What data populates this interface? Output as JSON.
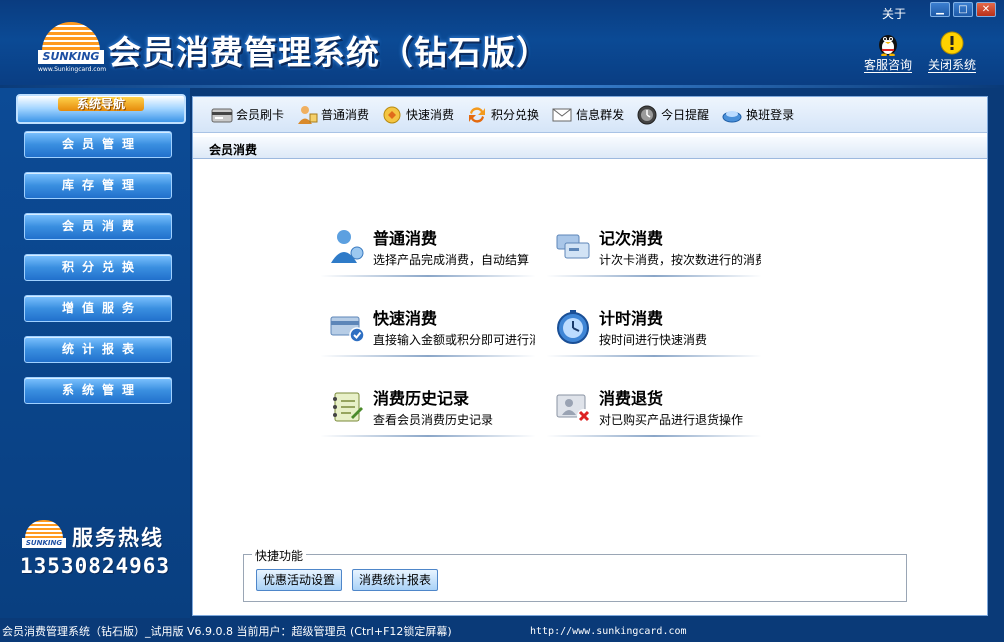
{
  "header": {
    "logo_text": "SUNKING",
    "logo_url": "www.Sunkingcard.com",
    "title": "会员消费管理系统（钻石版）",
    "about": "关于",
    "actions": [
      {
        "label": "客服咨询",
        "icon": "penguin-icon"
      },
      {
        "label": "关闭系统",
        "icon": "warning-icon"
      }
    ]
  },
  "sidebar": {
    "header": "系统导航",
    "items": [
      {
        "label": "会员管理"
      },
      {
        "label": "库存管理"
      },
      {
        "label": "会员消费"
      },
      {
        "label": "积分兑换"
      },
      {
        "label": "增值服务"
      },
      {
        "label": "统计报表"
      },
      {
        "label": "系统管理"
      }
    ],
    "hotline_label": "服务热线",
    "hotline_number": "13530824963",
    "mini_logo_text": "SUNKING"
  },
  "toolbar": {
    "items": [
      {
        "label": "会员刷卡",
        "icon": "card-reader-icon"
      },
      {
        "label": "普通消费",
        "icon": "user-purchase-icon"
      },
      {
        "label": "快速消费",
        "icon": "fast-purchase-icon"
      },
      {
        "label": "积分兑换",
        "icon": "exchange-icon"
      },
      {
        "label": "信息群发",
        "icon": "mail-icon"
      },
      {
        "label": "今日提醒",
        "icon": "reminder-icon"
      },
      {
        "label": "换班登录",
        "icon": "shift-login-icon"
      }
    ]
  },
  "page": {
    "section_title": "会员消费",
    "cards": [
      {
        "title": "普通消费",
        "desc": "选择产品完成消费，自动结算",
        "icon": "user-purchase-icon"
      },
      {
        "title": "记次消费",
        "desc": "计次卡消费，按次数进行的消费",
        "icon": "count-card-icon"
      },
      {
        "title": "快速消费",
        "desc": "直接输入金额或积分即可进行消",
        "icon": "fast-purchase-icon"
      },
      {
        "title": "计时消费",
        "desc": "按时间进行快速消费",
        "icon": "timer-icon"
      },
      {
        "title": "消费历史记录",
        "desc": "查看会员消费历史记录",
        "icon": "history-icon"
      },
      {
        "title": "消费退货",
        "desc": "对已购买产品进行退货操作",
        "icon": "return-icon"
      }
    ],
    "quick": {
      "title": "快捷功能",
      "buttons": [
        {
          "label": "优惠活动设置"
        },
        {
          "label": "消费统计报表"
        }
      ]
    }
  },
  "status": {
    "text": "会员消费管理系统（钻石版）_试用版 V6.9.0.8 当前用户：超级管理员 (Ctrl+F12锁定屏幕)",
    "url": "http://www.sunkingcard.com"
  },
  "colors": {
    "frame": "#0a3a78",
    "accent": "#2170cc",
    "panel": "#ffffff"
  }
}
